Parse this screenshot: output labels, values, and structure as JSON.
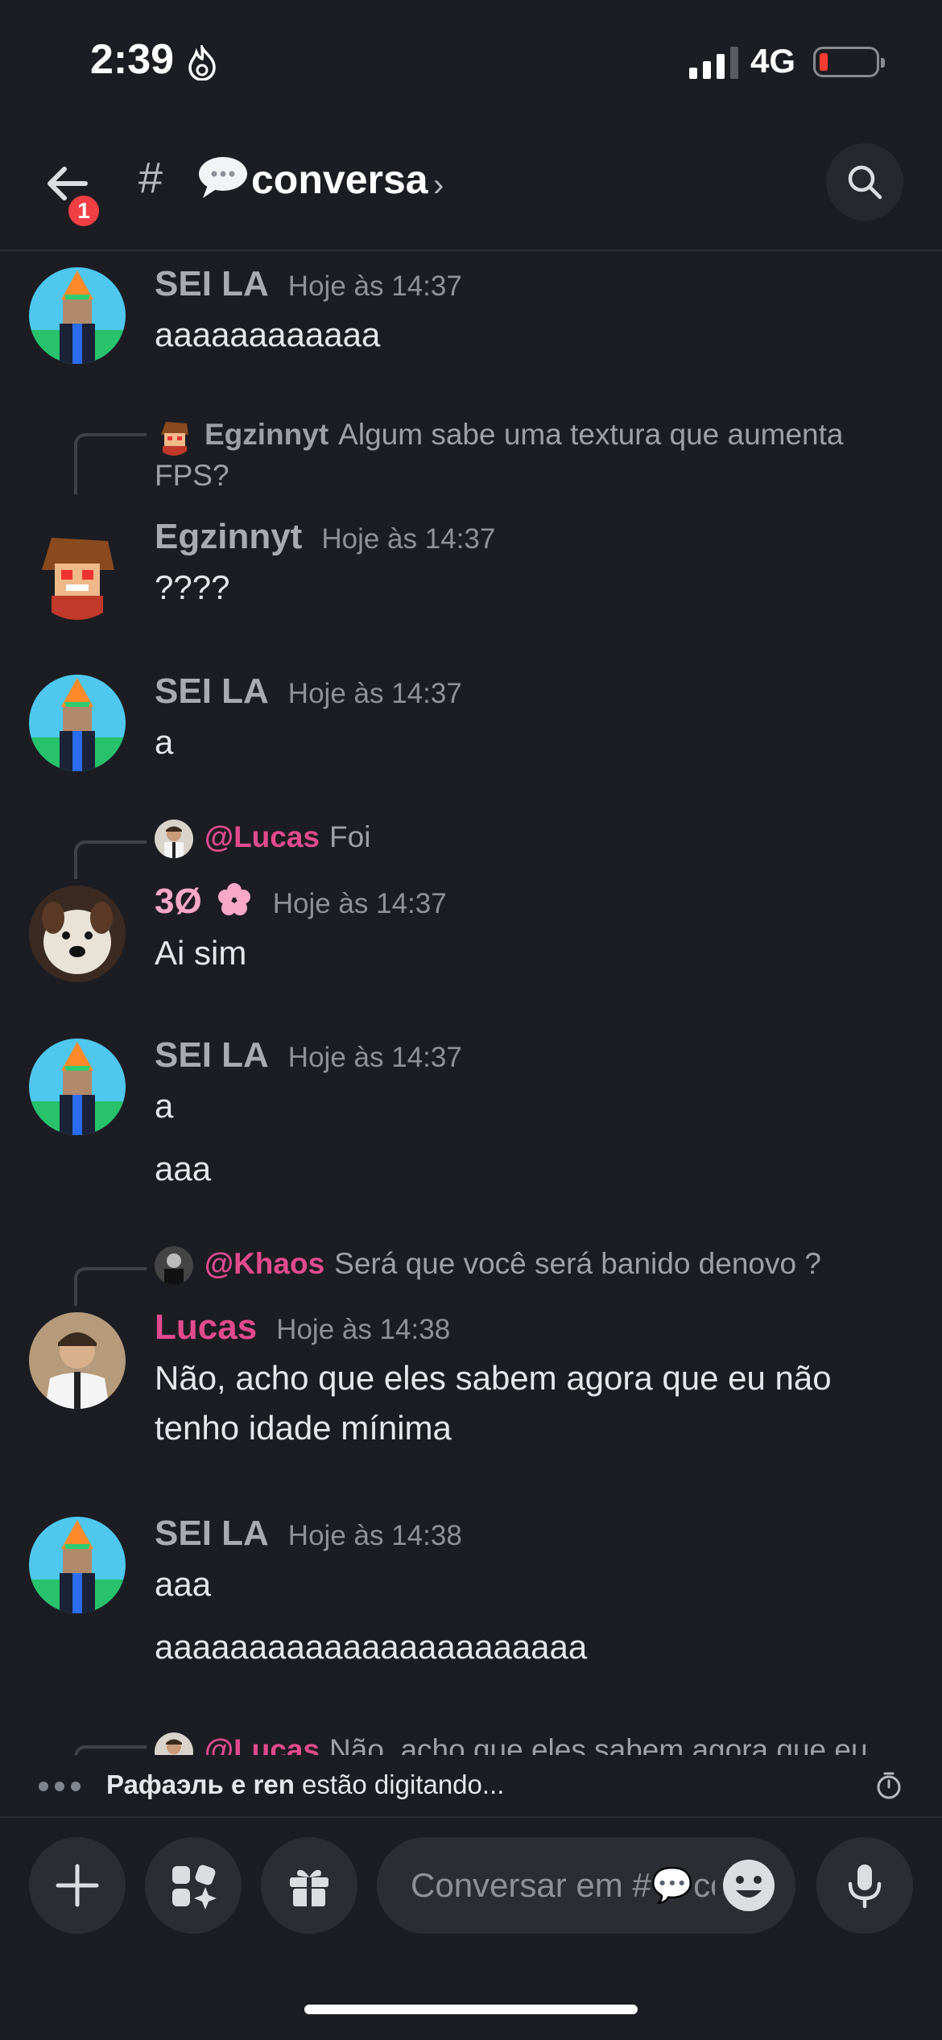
{
  "status_bar": {
    "time": "2:39",
    "network": "4G"
  },
  "header": {
    "channel_name": "conversa",
    "unread_badge": "1"
  },
  "messages": [
    {
      "author": "SEI LA",
      "timestamp": "Hoje às 14:37",
      "lines": [
        "aaaaaaaaaaaa"
      ]
    },
    {
      "reply": {
        "name": "Egzinnyt",
        "text": "Algum sabe uma textura que aumenta",
        "text2": "FPS?"
      },
      "author": "Egzinnyt",
      "timestamp": "Hoje às 14:37",
      "lines": [
        "????"
      ]
    },
    {
      "author": "SEI LA",
      "timestamp": "Hoje às 14:37",
      "lines": [
        "a"
      ]
    },
    {
      "reply": {
        "name": "@Lucas",
        "text": "Foi"
      },
      "author": "3Ø",
      "timestamp": "Hoje às 14:37",
      "lines": [
        "Ai sim"
      ]
    },
    {
      "author": "SEI LA",
      "timestamp": "Hoje às 14:37",
      "lines": [
        "a",
        "aaa"
      ]
    },
    {
      "reply": {
        "name": "@Khaos",
        "text": "Será que você será banido denovo ?"
      },
      "author": "Lucas",
      "timestamp": "Hoje às 14:38",
      "lines": [
        "Não, acho que eles sabem agora que eu não",
        "tenho idade mínima"
      ]
    },
    {
      "author": "SEI LA",
      "timestamp": "Hoje às 14:38",
      "lines": [
        "aaa",
        "aaaaaaaaaaaaaaaaaaaaaaa"
      ]
    },
    {
      "reply": {
        "name": "@Lucas",
        "text": "Não, acho que eles sabem agora que eu"
      }
    }
  ],
  "typing": {
    "names": "Рафаэль e ren",
    "suffix": "estão digitando..."
  },
  "composer": {
    "placeholder": "Conversar em #💬conversa"
  },
  "colors": {
    "background": "#1c1d22",
    "mention_pink": "#e14b8e",
    "badge_red": "#f23f43",
    "role_pink": "#f9a8c8"
  }
}
